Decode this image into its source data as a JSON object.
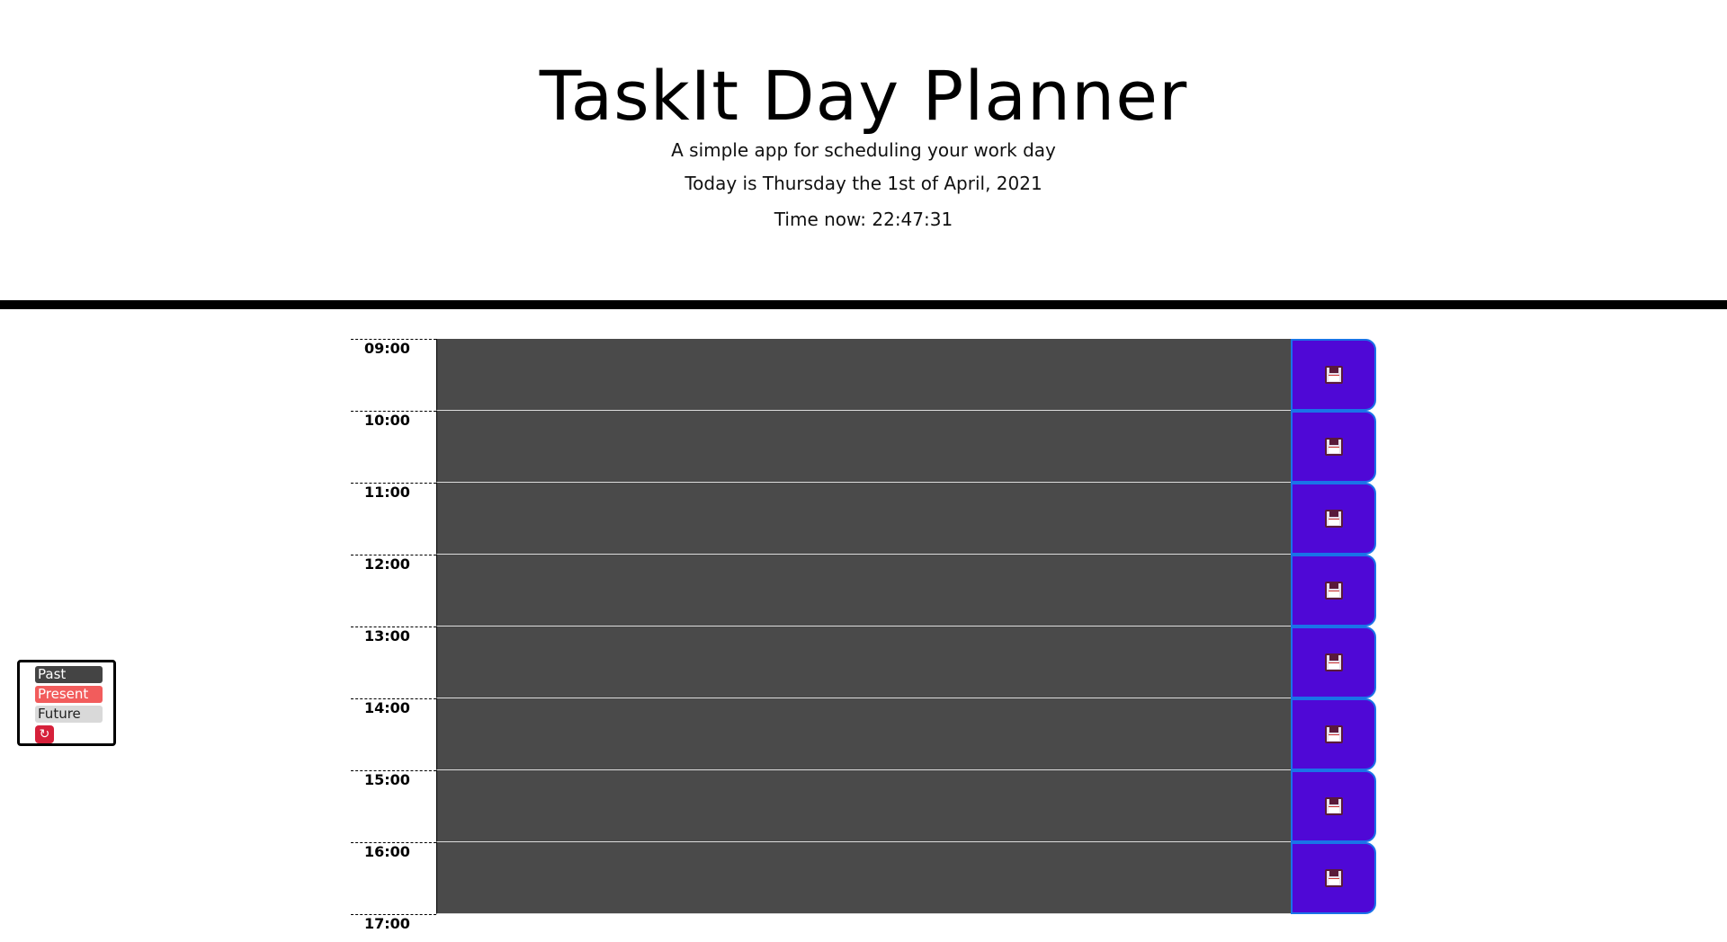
{
  "header": {
    "title": "TaskIt Day Planner",
    "subtitle": "A simple app for scheduling your work day",
    "today": "Today is Thursday the 1st of April, 2021",
    "time_now": "Time now: 22:47:31"
  },
  "planner": {
    "hours": [
      "09:00",
      "10:00",
      "11:00",
      "12:00",
      "13:00",
      "14:00",
      "15:00",
      "16:00"
    ],
    "final_hour": "17:00",
    "save_icon": "floppy-disk-icon"
  },
  "legend": {
    "past": "Past",
    "present": "Present",
    "future": "Future",
    "reset_icon": "↻"
  },
  "colors": {
    "past": "#4a4a4a",
    "present": "#f25c5c",
    "future": "#d9d9d9",
    "save_button": "#4f08d6"
  }
}
